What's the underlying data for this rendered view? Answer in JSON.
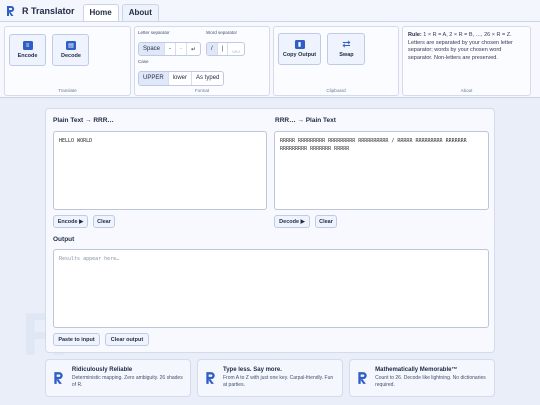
{
  "app": {
    "title": "R Translator"
  },
  "tabs": [
    {
      "label": "Home"
    },
    {
      "label": "About"
    }
  ],
  "ribbon": {
    "translate": {
      "encode_label": "Encode",
      "decode_label": "Decode",
      "group_label": "Translate"
    },
    "format": {
      "letter_sep_label": "Letter separator",
      "letter_sep_options": [
        "Space",
        "-",
        "·",
        "↵"
      ],
      "letter_sep_selected": "Space",
      "word_sep_label": "Word separator",
      "word_sep_options": [
        "/",
        "|",
        "␣␣"
      ],
      "word_sep_selected": "/",
      "case_label": "Case",
      "case_options": [
        "UPPER",
        "lower",
        "As typed"
      ],
      "case_selected": "UPPER",
      "group_label": "Format"
    },
    "clipboard": {
      "copy_label": "Copy Output",
      "swap_label": "Swap",
      "group_label": "Clipboard"
    },
    "about": {
      "rule_title": "Rule:",
      "rule_text": " 1 × R = A, 2 × R = B, …, 26 × R = Z. Letters are separated by your chosen letter separator; words by your chosen word separator. Non-letters are preserved.",
      "group_label": "About"
    }
  },
  "main": {
    "plain_title": "Plain Text → RRR…",
    "plain_value": "HELLO WORLD",
    "encode_btn": "Encode ▶",
    "clear_left_btn": "Clear",
    "rrr_title": "RRR… → Plain Text",
    "rrr_value": "RRRRR RRRRRRRRR RRRRRRRRR RRRRRRRRRR / RRRRR RRRRRRRRR RRRRRRR RRRRRRRRR RRRRRRR RRRRR",
    "decode_btn": "Decode ▶",
    "clear_right_btn": "Clear",
    "output_title": "Output",
    "output_placeholder": "Results appear here…",
    "paste_btn": "Paste to input",
    "clear_output_btn": "Clear output"
  },
  "features": [
    {
      "title": "Ridiculously Reliable",
      "desc": "Deterministic mapping. Zero ambiguity. 26 shades of R."
    },
    {
      "title": "Type less. Say more.",
      "desc": "From A to Z with just one key. Carpal-friendly. Fun at parties."
    },
    {
      "title": "Mathematically Memorable™",
      "desc": "Count to 26. Decode like lightning. No dictionaries required."
    }
  ],
  "colors": {
    "accent": "#2f5fc4",
    "background": "#e9eef8"
  },
  "icons": {
    "encode": "document-icon",
    "decode": "chat-icon",
    "copy": "bookmark-icon",
    "swap": "swap-arrows-icon",
    "logo": "r-logo-icon"
  }
}
